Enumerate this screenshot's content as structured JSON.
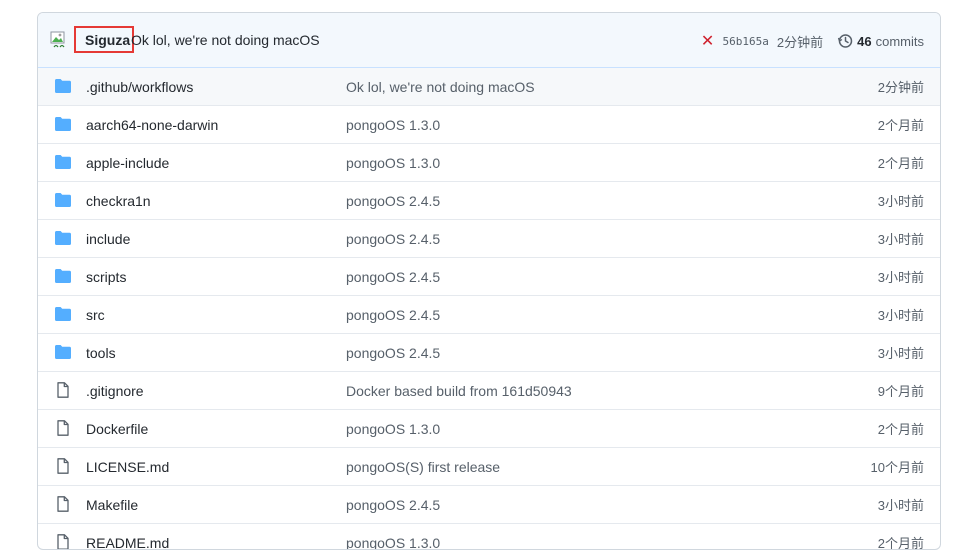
{
  "commit": {
    "author": "Siguza",
    "message": "Ok lol, we're not doing macOS",
    "sha": "56b165a",
    "age": "2分钟前",
    "commits_count": "46",
    "commits_label": "commits",
    "status_color": "#cf222e"
  },
  "files": [
    {
      "type": "folder",
      "name": ".github/workflows",
      "message": "Ok lol, we're not doing macOS",
      "age": "2分钟前"
    },
    {
      "type": "folder",
      "name": "aarch64-none-darwin",
      "message": "pongoOS 1.3.0",
      "age": "2个月前"
    },
    {
      "type": "folder",
      "name": "apple-include",
      "message": "pongoOS 1.3.0",
      "age": "2个月前"
    },
    {
      "type": "folder",
      "name": "checkra1n",
      "message": "pongoOS 2.4.5",
      "age": "3小时前"
    },
    {
      "type": "folder",
      "name": "include",
      "message": "pongoOS 2.4.5",
      "age": "3小时前"
    },
    {
      "type": "folder",
      "name": "scripts",
      "message": "pongoOS 2.4.5",
      "age": "3小时前"
    },
    {
      "type": "folder",
      "name": "src",
      "message": "pongoOS 2.4.5",
      "age": "3小时前"
    },
    {
      "type": "folder",
      "name": "tools",
      "message": "pongoOS 2.4.5",
      "age": "3小时前"
    },
    {
      "type": "file",
      "name": ".gitignore",
      "message": "Docker based build from 161d50943",
      "age": "9个月前"
    },
    {
      "type": "file",
      "name": "Dockerfile",
      "message": "pongoOS 1.3.0",
      "age": "2个月前"
    },
    {
      "type": "file",
      "name": "LICENSE.md",
      "message": "pongoOS(S) first release",
      "age": "10个月前"
    },
    {
      "type": "file",
      "name": "Makefile",
      "message": "pongoOS 2.4.5",
      "age": "3小时前"
    },
    {
      "type": "file",
      "name": "README.md",
      "message": "pongoOS 1.3.0",
      "age": "2个月前"
    }
  ],
  "colors": {
    "folder": "#54aeff",
    "file": "#57606a",
    "header_bg": "#f3f8fd"
  }
}
